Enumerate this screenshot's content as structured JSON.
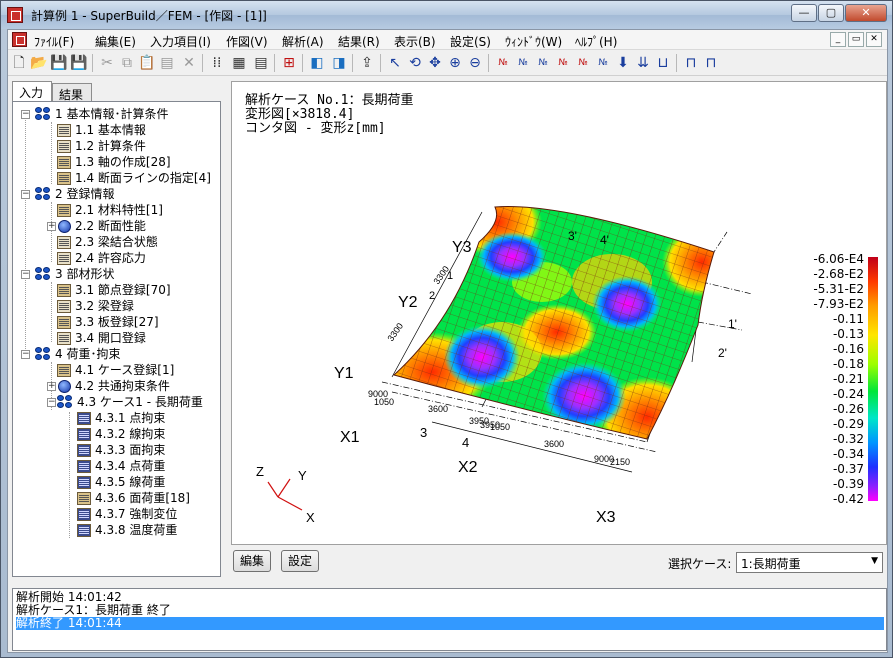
{
  "window": {
    "title": "計算例 1 - SuperBuild／FEM - [作図 - [1]]"
  },
  "menu": {
    "items": [
      "ﾌｧｲﾙ(F)",
      "編集(E)",
      "入力項目(I)",
      "作図(V)",
      "解析(A)",
      "結果(R)",
      "表示(B)",
      "設定(S)",
      "ｳｨﾝﾄﾞｳ(W)",
      "ﾍﾙﾌﾟ(H)"
    ]
  },
  "left_tabs": [
    "入力",
    "結果"
  ],
  "tree": [
    {
      "label": "1 基本情報･計算条件"
    },
    {
      "label": "1.1 基本情報"
    },
    {
      "label": "1.2 計算条件"
    },
    {
      "label": "1.3 軸の作成[28]"
    },
    {
      "label": "1.4 断面ラインの指定[4]"
    },
    {
      "label": "2 登録情報"
    },
    {
      "label": "2.1 材料特性[1]"
    },
    {
      "label": "2.2 断面性能"
    },
    {
      "label": "2.3 梁結合状態"
    },
    {
      "label": "2.4 許容応力"
    },
    {
      "label": "3 部材形状"
    },
    {
      "label": "3.1 節点登録[70]"
    },
    {
      "label": "3.2 梁登録"
    },
    {
      "label": "3.3 板登録[27]"
    },
    {
      "label": "3.4 開口登録"
    },
    {
      "label": "4 荷重･拘束"
    },
    {
      "label": "4.1 ケース登録[1]"
    },
    {
      "label": "4.2 共通拘束条件"
    },
    {
      "label": "4.3 ケース1 - 長期荷重"
    },
    {
      "label": "4.3.1 点拘束"
    },
    {
      "label": "4.3.2 線拘束"
    },
    {
      "label": "4.3.3 面拘束"
    },
    {
      "label": "4.3.4 点荷重"
    },
    {
      "label": "4.3.5 線荷重"
    },
    {
      "label": "4.3.6 面荷重[18]"
    },
    {
      "label": "4.3.7 強制変位"
    },
    {
      "label": "4.3.8 温度荷重"
    }
  ],
  "view": {
    "header_line1": "解析ケース No.1：長期荷重",
    "header_line2": "変形図[×3818.4]",
    "header_line3": "コンタ図 - 変形z[mm]",
    "grid_labels": {
      "x1": "X1",
      "x2": "X2",
      "x3": "X3",
      "y1": "Y1",
      "y2": "Y2",
      "y3": "Y3",
      "n1": "1",
      "n2": "2",
      "n3": "3",
      "n4": "4",
      "n1p": "1'",
      "n2p": "2'",
      "n3p": "3'",
      "n4p": "4'",
      "d3300a": "3300",
      "d3300b": "3300",
      "d3600a": "3600",
      "d3600b": "3600",
      "d3950": "3950",
      "d9000a": "9000",
      "d9000b": "9000",
      "d2150": "2150",
      "d1050": "1050",
      "d1050b": "1050",
      "d3950b": "3950"
    },
    "axes": {
      "z": "Z",
      "y": "Y",
      "x": "X"
    },
    "legend": [
      "-6.06-E4",
      "-2.68-E2",
      "-5.31-E2",
      "-7.93-E2",
      "-0.11",
      "-0.13",
      "-0.16",
      "-0.18",
      "-0.21",
      "-0.24",
      "-0.26",
      "-0.29",
      "-0.32",
      "-0.34",
      "-0.37",
      "-0.39",
      "-0.42"
    ]
  },
  "buttons": {
    "edit": "編集",
    "settings": "設定"
  },
  "case_select": {
    "label": "選択ケース:",
    "value": "1:長期荷重"
  },
  "log": [
    "解析開始  14:01:42",
    "解析ケース1：長期荷重  終了",
    "解析終了  14:01:44"
  ]
}
